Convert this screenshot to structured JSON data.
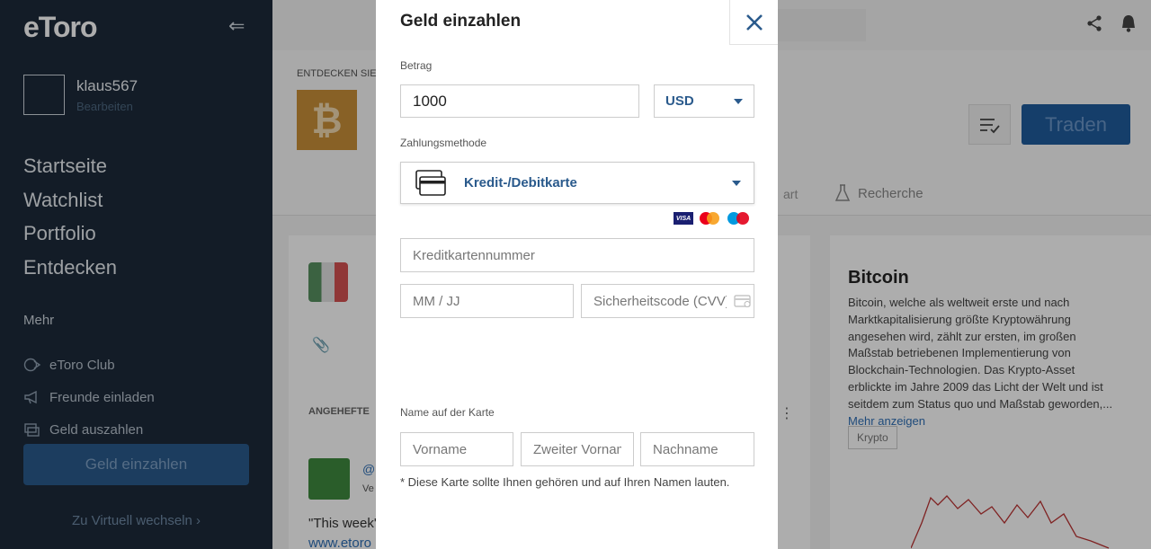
{
  "sidebar": {
    "logo": "eToro",
    "username": "klaus567",
    "edit_label": "Bearbeiten",
    "nav": [
      "Startseite",
      "Watchlist",
      "Portfolio",
      "Entdecken"
    ],
    "more_label": "Mehr",
    "sub_items": [
      {
        "label": "eToro Club",
        "icon": "club-icon"
      },
      {
        "label": "Freunde einladen",
        "icon": "megaphone-icon"
      },
      {
        "label": "Geld auszahlen",
        "icon": "withdraw-icon"
      }
    ],
    "deposit_label": "Geld einzahlen",
    "virtual_label": "Zu Virtuell wechseln ›"
  },
  "page": {
    "breadcrumb": "ENTDECKEN SIE  /",
    "trade_label": "Traden",
    "tab_partial": "art",
    "tab_research": "Recherche",
    "feed": {
      "pinned_label": "ANGEHEFTE",
      "handle": "@",
      "verified": "Ve",
      "quote": "\"This week's",
      "url": "www.etoro"
    },
    "info": {
      "title": "Bitcoin",
      "description": "Bitcoin, welche als weltweit erste und nach Marktkapitalisierung größte Kryptowährung angesehen wird, zählt zur ersten, im großen Maßstab betriebenen Implementierung von Blockchain-Technologien. Das Krypto-Asset erblickte im Jahre 2009 das Licht der Welt und ist seitdem zum Status quo und Maßstab geworden,...",
      "more_label": "Mehr anzeigen",
      "tag": "Krypto"
    }
  },
  "modal": {
    "title": "Geld einzahlen",
    "amount_label": "Betrag",
    "amount_value": "1000",
    "currency": "USD",
    "method_label": "Zahlungsmethode",
    "method_value": "Kredit-/Debitkarte",
    "card_brands": [
      "VISA",
      "Mastercard",
      "Maestro"
    ],
    "card_number_placeholder": "Kreditkartennummer",
    "expiry_placeholder": "MM / JJ",
    "cvv_placeholder": "Sicherheitscode (CVV)",
    "name_label": "Name auf der Karte",
    "first_name_placeholder": "Vorname",
    "middle_name_placeholder": "Zweiter Vorname",
    "last_name_placeholder": "Nachname",
    "note": "* Diese Karte sollte Ihnen gehören und auf Ihren Namen lauten."
  },
  "colors": {
    "sidebar_bg": "#1c2a3a",
    "accent": "#2a5a8c",
    "bitcoin": "#c99038"
  }
}
